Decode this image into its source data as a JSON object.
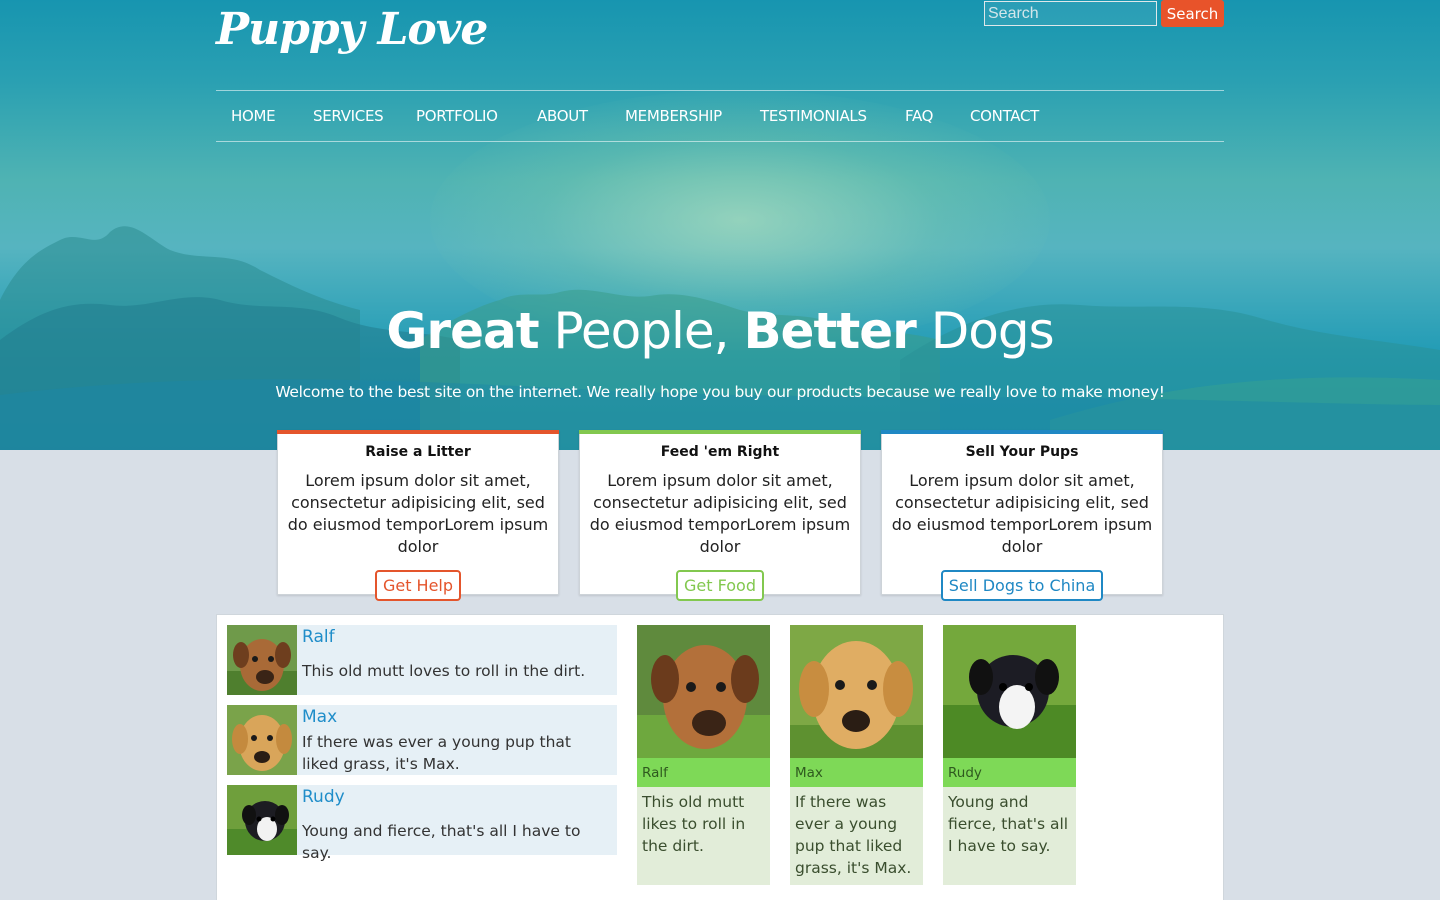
{
  "brand": {
    "logo": "Puppy Love"
  },
  "search": {
    "placeholder": "Search",
    "button": "Search"
  },
  "nav": {
    "items": [
      "HOME",
      "SERVICES",
      "PORTFOLIO",
      "ABOUT",
      "MEMBERSHIP",
      "TESTIMONIALS",
      "FAQ",
      "CONTACT"
    ]
  },
  "hero": {
    "headline_1": "Great",
    "headline_2": " People, ",
    "headline_3": "Better",
    "headline_4": " Dogs",
    "tagline": "Welcome to the best site on the internet. We really hope you buy our products because we really love to make money!"
  },
  "cards": [
    {
      "title": "Raise a Litter",
      "text": "Lorem ipsum dolor sit amet, consectetur adipisicing elit, sed do eiusmod temporLorem ipsum dolor",
      "button": "Get Help",
      "color": "#e4552c"
    },
    {
      "title": "Feed 'em Right",
      "text": "Lorem ipsum dolor sit amet, consectetur adipisicing elit, sed do eiusmod temporLorem ipsum dolor",
      "button": "Get Food",
      "color": "#82c84f"
    },
    {
      "title": "Sell Your Pups",
      "text": "Lorem ipsum dolor sit amet, consectetur adipisicing elit, sed do eiusmod temporLorem ipsum dolor",
      "button": "Sell Dogs to China",
      "color": "#1f88c4"
    }
  ],
  "dog_list": [
    {
      "name": "Ralf",
      "desc": "This old mutt loves to roll in the dirt."
    },
    {
      "name": "Max",
      "desc": "If there was ever a young pup that liked grass, it's Max."
    },
    {
      "name": "Rudy",
      "desc": "Young and fierce, that's all I have to say."
    }
  ],
  "dog_tiles": [
    {
      "name": "Ralf",
      "desc": "This old mutt likes to roll in the dirt."
    },
    {
      "name": "Max",
      "desc": "If there was ever a young pup that liked grass, it's Max."
    },
    {
      "name": "Rudy",
      "desc": "Young and fierce, that's all I have to say."
    }
  ]
}
